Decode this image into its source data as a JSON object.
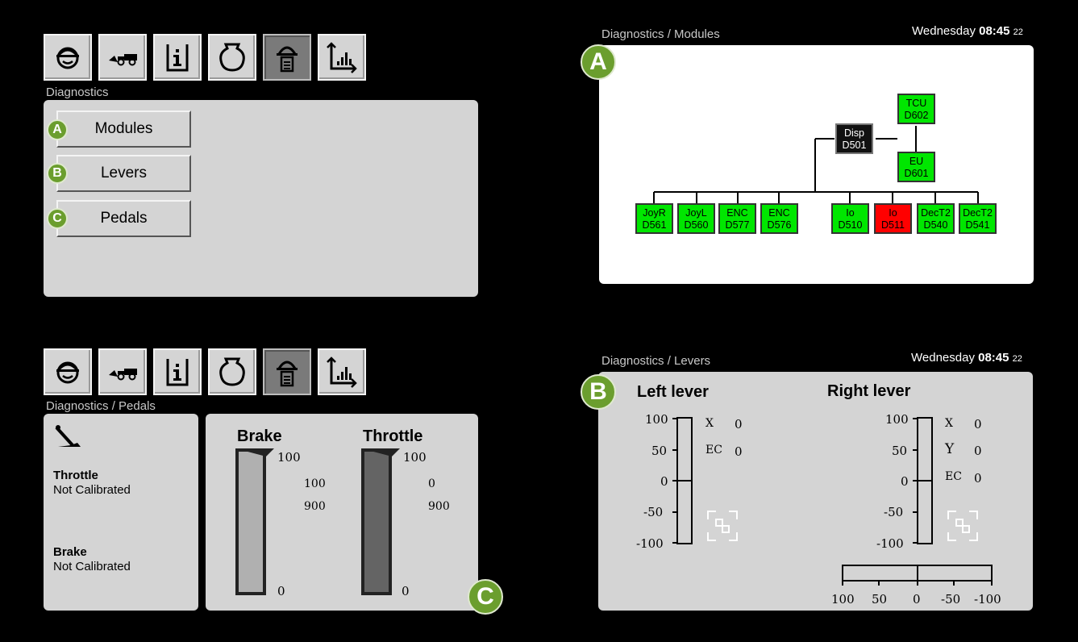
{
  "toolbar_icons": [
    "operator-icon",
    "loader-icon",
    "info-icon",
    "engine-icon",
    "diagnostics-icon",
    "chart-icon"
  ],
  "top_left": {
    "breadcrumb": "Diagnostics",
    "menu": [
      {
        "badge": "A",
        "label": "Modules"
      },
      {
        "badge": "B",
        "label": "Levers"
      },
      {
        "badge": "C",
        "label": "Pedals"
      }
    ]
  },
  "top_right": {
    "breadcrumb": "Diagnostics / Modules",
    "clock": {
      "day": "Wednesday",
      "time": "08:45",
      "seconds": "22"
    },
    "badge": "A",
    "nodes": {
      "tcu": {
        "name": "TCU",
        "id": "D602"
      },
      "disp": {
        "name": "Disp",
        "id": "D501"
      },
      "eu": {
        "name": "EU",
        "id": "D601"
      },
      "joyr": {
        "name": "JoyR",
        "id": "D561"
      },
      "joyl": {
        "name": "JoyL",
        "id": "D560"
      },
      "enc1": {
        "name": "ENC",
        "id": "D577"
      },
      "enc2": {
        "name": "ENC",
        "id": "D576"
      },
      "io1": {
        "name": "Io",
        "id": "D510"
      },
      "io2": {
        "name": "Io",
        "id": "D511"
      },
      "dect1": {
        "name": "DecT2",
        "id": "D540"
      },
      "dect2": {
        "name": "DecT2",
        "id": "D541"
      }
    },
    "colors": {
      "ok": "#00e600",
      "fault": "#ff0000",
      "display": "#111111"
    }
  },
  "bottom_left": {
    "breadcrumb": "Diagnostics / Pedals",
    "throttle": {
      "title": "Throttle",
      "status": "Not Calibrated"
    },
    "brake": {
      "title": "Brake",
      "status": "Not Calibrated"
    },
    "gauges": {
      "brake": {
        "title": "Brake",
        "top": "100",
        "bottom": "0",
        "val1": "100",
        "val2": "900"
      },
      "throttle": {
        "title": "Throttle",
        "top": "100",
        "bottom": "0",
        "val1": "0",
        "val2": "900"
      }
    },
    "badge": "C"
  },
  "bottom_right": {
    "breadcrumb": "Diagnostics / Levers",
    "clock": {
      "day": "Wednesday",
      "time": "08:45",
      "seconds": "22"
    },
    "badge": "B",
    "left_lever": {
      "title": "Left lever",
      "ticks": [
        "100",
        "50",
        "0",
        "-50",
        "-100"
      ],
      "rows": [
        {
          "key": "X",
          "val": "0"
        },
        {
          "key": "EC",
          "val": "0"
        }
      ]
    },
    "right_lever": {
      "title": "Right lever",
      "ticks": [
        "100",
        "50",
        "0",
        "-50",
        "-100"
      ],
      "rows": [
        {
          "key": "X",
          "val": "0"
        },
        {
          "key": "Y",
          "val": "0"
        },
        {
          "key": "EC",
          "val": "0"
        }
      ]
    },
    "h_scale": [
      "100",
      "50",
      "0",
      "-50",
      "-100"
    ]
  }
}
